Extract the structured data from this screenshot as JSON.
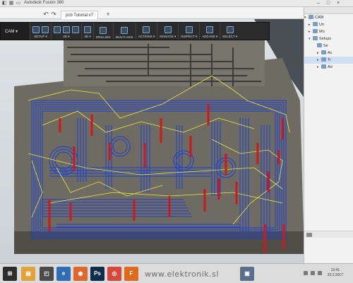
{
  "window": {
    "title": "Autodesk Fusion 360"
  },
  "tabs": [
    {
      "label": "pcb Tutorial v7"
    }
  ],
  "toolbar": {
    "mode": "CAM ▾",
    "groups": [
      {
        "label": "SETUP ▾",
        "icons": 2
      },
      {
        "label": "2D ▾",
        "icons": 3
      },
      {
        "label": "3D ▾",
        "icons": 1
      },
      {
        "label": "DRILLING",
        "icons": 1
      },
      {
        "label": "MULTI-AXIS",
        "icons": 1
      },
      {
        "label": "ACTIONS ▾",
        "icons": 1
      },
      {
        "label": "MANAGE ▾",
        "icons": 1
      },
      {
        "label": "INSPECT ▾",
        "icons": 1
      },
      {
        "label": "ADD-INS ▾",
        "icons": 1
      },
      {
        "label": "SELECT ▾",
        "icons": 1
      }
    ]
  },
  "browser": {
    "rows": [
      {
        "label": "CAM",
        "tri": "▾",
        "selected": false
      },
      {
        "label": "Un",
        "tri": "▸",
        "selected": false
      },
      {
        "label": "Mo",
        "tri": "▸",
        "selected": false
      },
      {
        "label": "Setups",
        "tri": "▾",
        "selected": false
      },
      {
        "label": "Se",
        "tri": "",
        "selected": false
      },
      {
        "label": "Ac",
        "tri": "▸",
        "selected": false
      },
      {
        "label": "Tr",
        "tri": "▸",
        "selected": true
      },
      {
        "label": "Ad",
        "tri": "▸",
        "selected": false
      }
    ]
  },
  "taskbar": {
    "apps": [
      {
        "name": "start",
        "color": "#2d2d2d",
        "glyph": "⊞"
      },
      {
        "name": "file-explorer",
        "color": "#e2a23a",
        "glyph": "▤"
      },
      {
        "name": "store",
        "color": "#4a4a4a",
        "glyph": "◰"
      },
      {
        "name": "edge",
        "color": "#2f6db5",
        "glyph": "e"
      },
      {
        "name": "firefox",
        "color": "#e0672c",
        "glyph": "◉"
      },
      {
        "name": "photoshop",
        "color": "#0d2c4e",
        "glyph": "Ps"
      },
      {
        "name": "chrome",
        "color": "#d9463a",
        "glyph": "◎"
      },
      {
        "name": "fusion",
        "color": "#e06a1b",
        "glyph": "F"
      },
      {
        "name": "app-9",
        "color": "#5a6f8a",
        "glyph": "▣"
      }
    ],
    "website": "www.elektronik.sl",
    "clock_time": "12:41",
    "clock_date": "22.2.2017"
  },
  "colors": {
    "toolpath_blue": "#1a3fd6",
    "toolpath_yellow": "#e8e84a",
    "plunge_red": "#d01818"
  }
}
